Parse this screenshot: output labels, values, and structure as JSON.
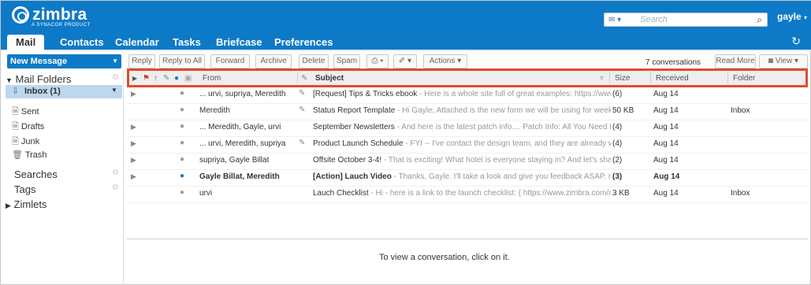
{
  "brand": {
    "logo": "zimbra",
    "tagline": "A SYNACOR PRODUCT"
  },
  "search": {
    "type": "envelope-icon",
    "placeholder": "Search"
  },
  "user": {
    "name": "gayle"
  },
  "tabs": [
    {
      "label": "Mail"
    },
    {
      "label": "Contacts"
    },
    {
      "label": "Calendar"
    },
    {
      "label": "Tasks"
    },
    {
      "label": "Briefcase"
    },
    {
      "label": "Preferences"
    }
  ],
  "sidebar": {
    "new_message": "New Message",
    "mail_folders": "Mail Folders",
    "folders": [
      {
        "label": "Inbox (1)",
        "icon": "inbox-icon"
      },
      {
        "label": "Sent",
        "icon": "sent-icon"
      },
      {
        "label": "Drafts",
        "icon": "drafts-icon"
      },
      {
        "label": "Junk",
        "icon": "junk-icon"
      },
      {
        "label": "Trash",
        "icon": "trash-icon"
      }
    ],
    "searches": "Searches",
    "tags": "Tags",
    "zimlets": "Zimlets"
  },
  "toolbar": {
    "reply": "Reply",
    "reply_all": "Reply to All",
    "forward": "Forward",
    "archive": "Archive",
    "delete": "Delete",
    "spam": "Spam",
    "actions": "Actions",
    "conversations": "7 conversations",
    "read_more": "Read More",
    "view": "View"
  },
  "columns": {
    "from": "From",
    "subject": "Subject",
    "size": "Size",
    "received": "Received",
    "folder": "Folder"
  },
  "messages": [
    {
      "from": "... urvi, supriya, Meredith",
      "subject": "[Request] Tips & Tricks ebook",
      "fragment": " - Here is a whole site full of great examples: https://www",
      "size": "(6)",
      "received": "Aug 14",
      "folder": "",
      "attachment": true,
      "expand": true
    },
    {
      "from": "Meredith",
      "subject": "Status Report Template",
      "fragment": " - Hi Gayle, Attached is the new form we will be using for weekly",
      "size": "50 KB",
      "received": "Aug 14",
      "folder": "Inbox",
      "attachment": true,
      "expand": false
    },
    {
      "from": "... Meredith, Gayle, urvi",
      "subject": "September Newsletters",
      "fragment": " - And here is the latest patch info.... Patch Info: All You Need to",
      "size": "(4)",
      "received": "Aug 14",
      "folder": "",
      "attachment": false,
      "expand": true
    },
    {
      "from": "... urvi, Meredith, supriya",
      "subject": "Product Launch Schedule",
      "fragment": " - FYI -- I've contact the design team, and they are already work",
      "size": "(4)",
      "received": "Aug 14",
      "folder": "",
      "attachment": true,
      "expand": true
    },
    {
      "from": "supriya, Gayle Billat",
      "subject": "Offsite October 3-4!",
      "fragment": " - That is exciting! What hotel is everyone staying in? And let's share",
      "size": "(2)",
      "received": "Aug 14",
      "folder": "",
      "attachment": false,
      "expand": true
    },
    {
      "from": "Gayle Billat, Meredith",
      "subject": "[Action] Lauch Video",
      "fragment": " - Thanks, Gayle. I'll take a look and give you feedback ASAP. m- Fi",
      "size": "(3)",
      "received": "Aug 14",
      "folder": "",
      "attachment": false,
      "expand": true,
      "unread": true
    },
    {
      "from": "urvi",
      "subject": "Lauch Checklist",
      "fragment": " - Hi - here is a link to the launch checklist: { https://www.zimbra.com/r",
      "size": "3 KB",
      "received": "Aug 14",
      "folder": "Inbox",
      "attachment": false,
      "expand": false
    }
  ],
  "reading_pane": {
    "hint": "To view a conversation, click on it."
  }
}
